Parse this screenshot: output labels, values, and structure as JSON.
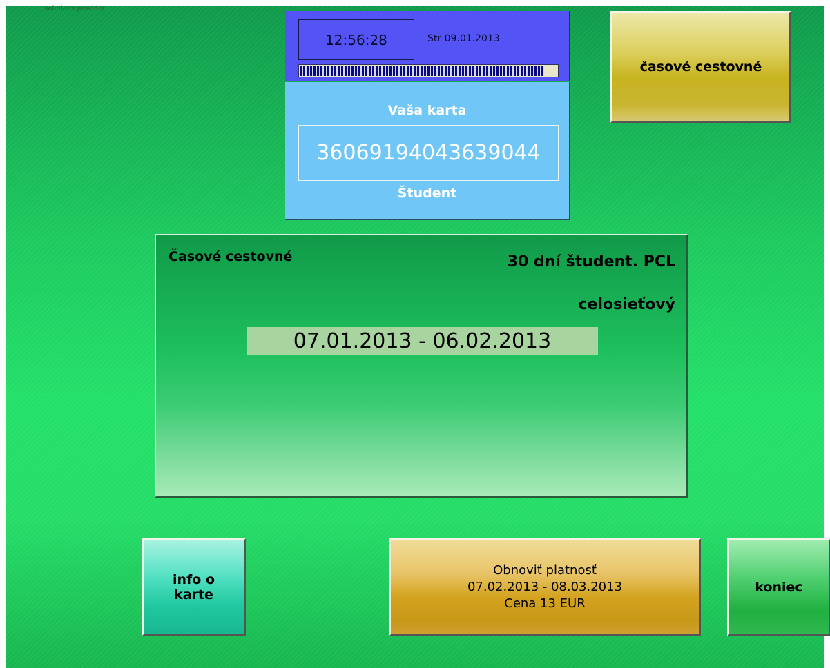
{
  "brand": {
    "text": "solutions provider"
  },
  "status": {
    "time": "12:56:28",
    "date": "Str 09.01.2013",
    "progress_fraction": 0.95
  },
  "card": {
    "title": "Vaša karta",
    "number": "3606919404363904​4",
    "type": "Študent"
  },
  "buttons": {
    "casove_cestovne": "časové cestovné",
    "info_line1": "info o",
    "info_line2": "karte",
    "obnovit_line1": "Obnoviť platnosť",
    "obnovit_line2": "07.02.2013 - 08.03.2013",
    "obnovit_line3": "Cena 13 EUR",
    "koniec": "koniec"
  },
  "ticket": {
    "label": "Časové cestovné",
    "name": "30 dní študent. PCL",
    "zone": "celosieťový",
    "validity": "07.01.2013 - 06.02.2013"
  },
  "colors": {
    "background": "#1cc95e",
    "clock_panel": "#5454f6",
    "card_panel": "#70c6f6",
    "casove_button": "#c8b420",
    "info_button": "#20c8a0",
    "obnovit_button": "#d4a420",
    "koniec_button": "#20b040"
  }
}
